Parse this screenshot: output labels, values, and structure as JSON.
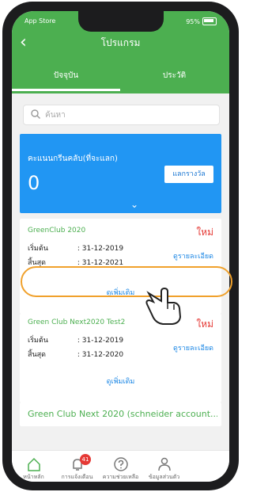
{
  "status_bar": {
    "carrier": "App Store",
    "battery": "95%"
  },
  "header": {
    "title": "โปรแกรม",
    "tabs": [
      "ปัจจุบัน",
      "ประวัติ"
    ]
  },
  "search": {
    "placeholder": "ค้นหา"
  },
  "points": {
    "label": "คะแนนกรีนคลับ(ที่จะแลก)",
    "value": "0",
    "redeem_label": "แลกรางวัล"
  },
  "programs": [
    {
      "name": "GreenClub 2020",
      "badge": "ใหม่",
      "start_label": "เริ่มต้น",
      "start": ": 31-12-2019",
      "end_label": "สิ้นสุด",
      "end": ": 31-12-2021",
      "detail_label": "ดูรายละเอียด",
      "more_label": "ดูเพิ่มเติม"
    },
    {
      "name": "Green Club Next2020 Test2",
      "badge": "ใหม่",
      "start_label": "เริ่มต้น",
      "start": ": 31-12-2019",
      "end_label": "สิ้นสุด",
      "end": ": 31-12-2020",
      "detail_label": "ดูรายละเอียด",
      "more_label": "ดูเพิ่มเติม"
    }
  ],
  "program3": {
    "name": "Green Club Next 2020 (schneider account..."
  },
  "bottom_nav": [
    {
      "label": "หน้าหลัก",
      "icon": "home-icon"
    },
    {
      "label": "การแจ้งเตือน",
      "icon": "bell-icon",
      "badge": "41"
    },
    {
      "label": "ความช่วยเหลือ",
      "icon": "help-icon"
    },
    {
      "label": "ข้อมูลส่วนตัว",
      "icon": "user-icon"
    }
  ],
  "colors": {
    "header": "#4caf50",
    "points_card": "#2196f3",
    "highlight": "#f0a12c",
    "badge": "#e53935"
  }
}
